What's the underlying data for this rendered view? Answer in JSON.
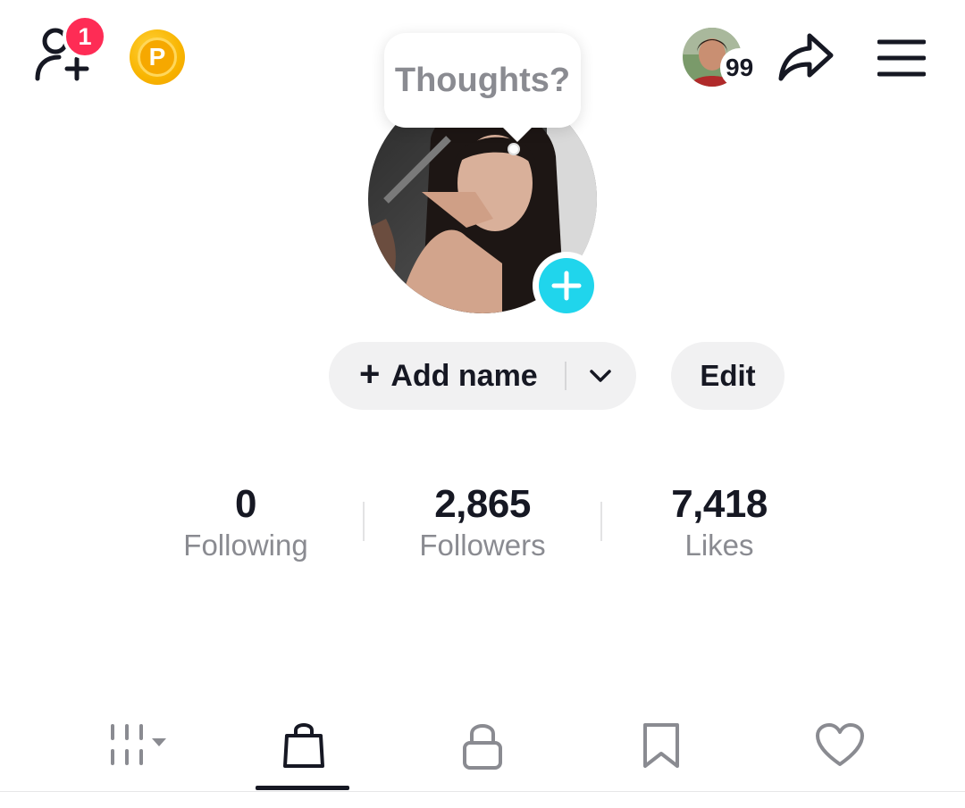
{
  "header": {
    "notification_count": "1",
    "coin_letter": "P",
    "story_count": "99"
  },
  "profile": {
    "bubble_text": "Thoughts?",
    "add_name_label": "Add name",
    "edit_label": "Edit"
  },
  "stats": [
    {
      "value": "0",
      "label": "Following"
    },
    {
      "value": "2,865",
      "label": "Followers"
    },
    {
      "value": "7,418",
      "label": "Likes"
    }
  ],
  "tabs": [
    {
      "icon": "grid-icon",
      "active": false
    },
    {
      "icon": "shopping-bag-icon",
      "active": true
    },
    {
      "icon": "lock-icon",
      "active": false
    },
    {
      "icon": "bookmark-icon",
      "active": false
    },
    {
      "icon": "heart-icon",
      "active": false
    }
  ],
  "colors": {
    "badge": "#fe2c55",
    "accent_add": "#20d5ec",
    "coin": "#f8b400",
    "muted_text": "#8a8b91",
    "button_bg": "#f1f1f2"
  }
}
